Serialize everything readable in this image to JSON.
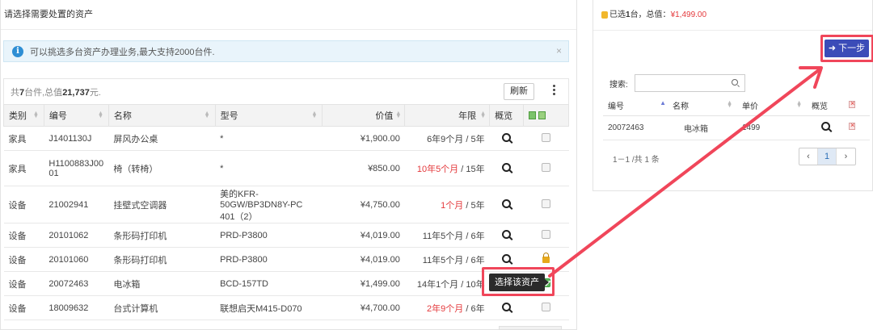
{
  "left": {
    "title": "请选择需要处置的资产",
    "alert_text": "可以挑选多台资产办理业务,最大支持2000台件.",
    "alert_close": "×",
    "summary_prefix": "共",
    "summary_count": "7",
    "summary_mid": "台件,总值",
    "summary_total": "21,737",
    "summary_suffix": "元.",
    "refresh_label": "刷新",
    "columns": [
      "类别",
      "编号",
      "名称",
      "型号",
      "价值",
      "年限",
      "概览"
    ],
    "rows": [
      {
        "category": "设备",
        "code": "",
        "name": "",
        "model": "",
        "value": "",
        "years_red": "",
        "years_rest": ""
      },
      {
        "category": "家具",
        "code": "J1401130J",
        "name": "屏风办公桌",
        "model": "*",
        "value": "¥1,900.00",
        "years_red": "",
        "years_rest": "6年9个月 / 5年"
      },
      {
        "category": "家具",
        "code": "H1100883J00 01",
        "name": "椅（转椅）",
        "model": "*",
        "value": "¥850.00",
        "years_red": "10年5个月",
        "years_rest": " / 15年"
      },
      {
        "category": "设备",
        "code": "21002941",
        "name": "挂壁式空调器",
        "model": "美的KFR-50GW/BP3DN8Y-PC 401（2）",
        "value": "¥4,750.00",
        "years_red": "1个月",
        "years_rest": " / 5年"
      },
      {
        "category": "设备",
        "code": "20101062",
        "name": "条形码打印机",
        "model": "PRD-P3800",
        "value": "¥4,019.00",
        "years_red": "",
        "years_rest": "11年5个月 / 6年"
      },
      {
        "category": "设备",
        "code": "20101060",
        "name": "条形码打印机",
        "model": "PRD-P3800",
        "value": "¥4,019.00",
        "years_red": "",
        "years_rest": "11年5个月 / 6年"
      },
      {
        "category": "设备",
        "code": "20072463",
        "name": "电冰箱",
        "model": "BCD-157TD",
        "value": "¥1,499.00",
        "years_red": "",
        "years_rest": "14年1个月 / 10年"
      },
      {
        "category": "设备",
        "code": "18009632",
        "name": "台式计算机",
        "model": "联想启天M415-D070",
        "value": "¥4,700.00",
        "years_red": "2年9个月",
        "years_rest": " / 6年"
      }
    ],
    "tooltip": "选择该资产"
  },
  "right": {
    "selected_prefix": "已选",
    "selected_count": "1",
    "selected_mid": "台，总值：",
    "selected_total": "¥1,499.00",
    "next_label": "➜ 下一步",
    "search_label": "搜索:",
    "search_value": "",
    "columns": [
      "编号",
      "名称",
      "单价",
      "概览"
    ],
    "rows": [
      {
        "code": "20072463",
        "name": "电冰箱",
        "price": "1499"
      }
    ],
    "pager_info": "1－1 /共 1 条",
    "pager_prev": "‹",
    "pager_page": "1",
    "pager_next": "›"
  },
  "colors": {
    "accent": "#3b4cb8",
    "highlight": "#f0465a",
    "link": "#2c86d0",
    "warning": "#e4393c"
  }
}
